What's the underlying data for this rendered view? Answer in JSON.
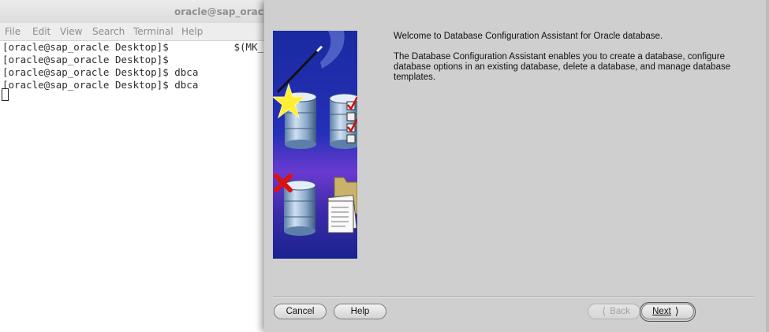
{
  "terminal": {
    "title": "oracle@sap_oracle",
    "menu": [
      "File",
      "Edit",
      "View",
      "Search",
      "Terminal",
      "Help"
    ],
    "lines": [
      "[oracle@sap_oracle Desktop]$           $(MK_E",
      "[oracle@sap_oracle Desktop]$",
      "[oracle@sap_oracle Desktop]$ dbca",
      "[oracle@sap_oracle Desktop]$ dbca"
    ]
  },
  "dialog": {
    "welcome": "Welcome to Database Configuration Assistant for Oracle database.",
    "description": "The Database Configuration Assistant enables you to create a database, configure database options in an existing database, delete a database, and manage database templates.",
    "buttons": {
      "cancel": "Cancel",
      "help": "Help",
      "back": "Back",
      "next": "Next",
      "back_icon": "chevron-left-icon",
      "next_icon": "chevron-right-icon"
    },
    "illustration_icons": [
      "magic-wand-icon",
      "database-create-icon",
      "database-configure-icon",
      "database-delete-icon",
      "template-folder-icon"
    ]
  },
  "colors": {
    "dialog_bg": "#cfcfcf",
    "illustration_top": "#1d2ea0",
    "illustration_glow": "#7b3fd0",
    "check_red": "#cc1111"
  }
}
